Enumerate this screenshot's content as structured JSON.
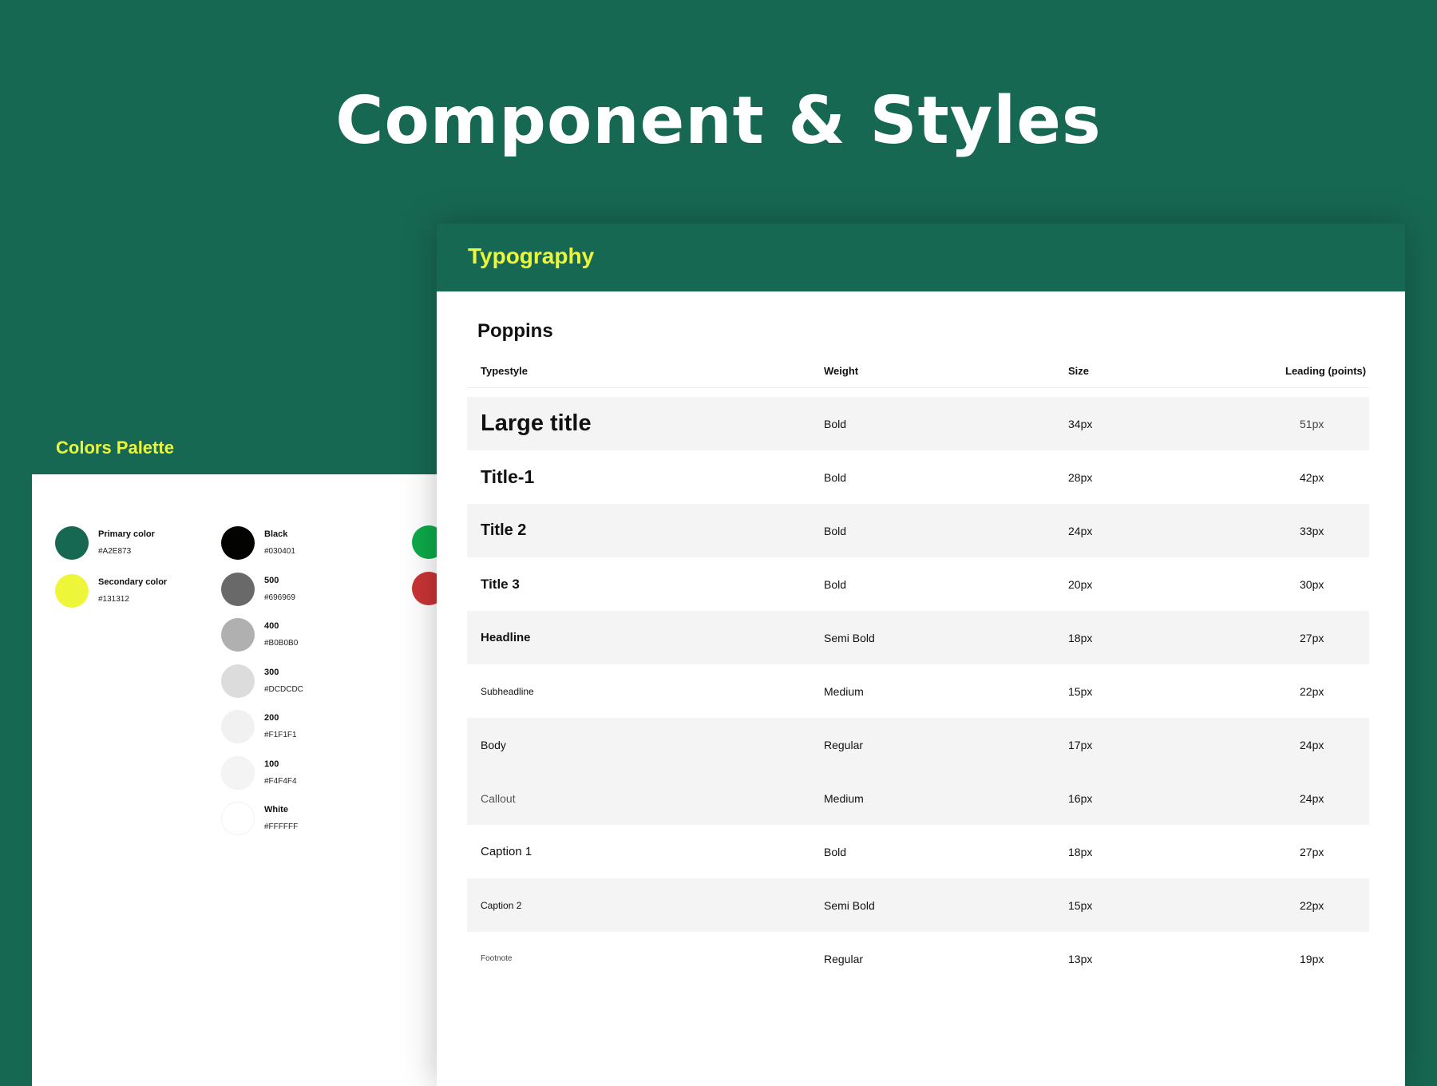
{
  "page_title": "Component & Styles",
  "palette": {
    "header": "Colors Palette",
    "brand": [
      {
        "name": "Primary color",
        "hex": "#A2E873",
        "color": "#176853"
      },
      {
        "name": "Secondary color",
        "hex": "#131312",
        "color": "#eef63a"
      }
    ],
    "grays": [
      {
        "name": "Black",
        "hex": "#030401",
        "color": "#030401"
      },
      {
        "name": "500",
        "hex": "#696969",
        "color": "#696969"
      },
      {
        "name": "400",
        "hex": "#B0B0B0",
        "color": "#B0B0B0"
      },
      {
        "name": "300",
        "hex": "#DCDCDC",
        "color": "#DCDCDC"
      },
      {
        "name": "200",
        "hex": "#F1F1F1",
        "color": "#F1F1F1"
      },
      {
        "name": "100",
        "hex": "#F4F4F4",
        "color": "#F4F4F4"
      },
      {
        "name": "White",
        "hex": "#FFFFFF",
        "color": "#FFFFFF"
      }
    ],
    "status": [
      {
        "color": "#0ea94a"
      },
      {
        "color": "#c93434"
      }
    ]
  },
  "typography": {
    "header": "Typography",
    "font": "Poppins",
    "columns": [
      "Typestyle",
      "Weight",
      "Size",
      "Leading (points)"
    ],
    "rows": [
      {
        "style": "Large title",
        "weight": "Bold",
        "size": "34px",
        "leading": "51px"
      },
      {
        "style": "Title-1",
        "weight": "Bold",
        "size": "28px",
        "leading": "42px"
      },
      {
        "style": "Title 2",
        "weight": "Bold",
        "size": "24px",
        "leading": "33px"
      },
      {
        "style": "Title 3",
        "weight": "Bold",
        "size": "20px",
        "leading": "30px"
      },
      {
        "style": "Headline",
        "weight": "Semi Bold",
        "size": "18px",
        "leading": "27px"
      },
      {
        "style": "Subheadline",
        "weight": "Medium",
        "size": "15px",
        "leading": "22px"
      },
      {
        "style": "Body",
        "weight": "Regular",
        "size": "17px",
        "leading": "24px"
      },
      {
        "style": "Callout",
        "weight": "Medium",
        "size": "16px",
        "leading": "24px"
      },
      {
        "style": "Caption 1",
        "weight": "Bold",
        "size": "18px",
        "leading": "27px"
      },
      {
        "style": "Caption 2",
        "weight": "Semi Bold",
        "size": "15px",
        "leading": "22px"
      },
      {
        "style": "Footnote",
        "weight": "Regular",
        "size": "13px",
        "leading": "19px"
      }
    ]
  }
}
